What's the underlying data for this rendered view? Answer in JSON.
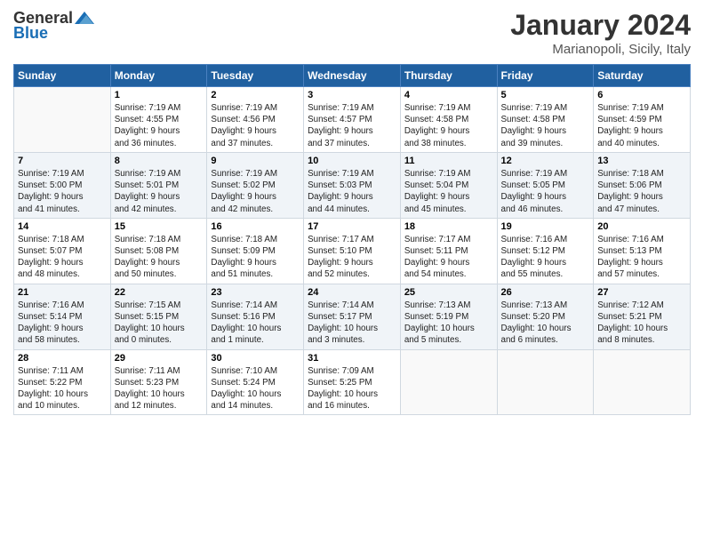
{
  "header": {
    "logo_general": "General",
    "logo_blue": "Blue",
    "month_title": "January 2024",
    "location": "Marianopoli, Sicily, Italy"
  },
  "days_of_week": [
    "Sunday",
    "Monday",
    "Tuesday",
    "Wednesday",
    "Thursday",
    "Friday",
    "Saturday"
  ],
  "weeks": [
    [
      {
        "day": "",
        "info": ""
      },
      {
        "day": "1",
        "info": "Sunrise: 7:19 AM\nSunset: 4:55 PM\nDaylight: 9 hours\nand 36 minutes."
      },
      {
        "day": "2",
        "info": "Sunrise: 7:19 AM\nSunset: 4:56 PM\nDaylight: 9 hours\nand 37 minutes."
      },
      {
        "day": "3",
        "info": "Sunrise: 7:19 AM\nSunset: 4:57 PM\nDaylight: 9 hours\nand 37 minutes."
      },
      {
        "day": "4",
        "info": "Sunrise: 7:19 AM\nSunset: 4:58 PM\nDaylight: 9 hours\nand 38 minutes."
      },
      {
        "day": "5",
        "info": "Sunrise: 7:19 AM\nSunset: 4:58 PM\nDaylight: 9 hours\nand 39 minutes."
      },
      {
        "day": "6",
        "info": "Sunrise: 7:19 AM\nSunset: 4:59 PM\nDaylight: 9 hours\nand 40 minutes."
      }
    ],
    [
      {
        "day": "7",
        "info": "Sunrise: 7:19 AM\nSunset: 5:00 PM\nDaylight: 9 hours\nand 41 minutes."
      },
      {
        "day": "8",
        "info": "Sunrise: 7:19 AM\nSunset: 5:01 PM\nDaylight: 9 hours\nand 42 minutes."
      },
      {
        "day": "9",
        "info": "Sunrise: 7:19 AM\nSunset: 5:02 PM\nDaylight: 9 hours\nand 42 minutes."
      },
      {
        "day": "10",
        "info": "Sunrise: 7:19 AM\nSunset: 5:03 PM\nDaylight: 9 hours\nand 44 minutes."
      },
      {
        "day": "11",
        "info": "Sunrise: 7:19 AM\nSunset: 5:04 PM\nDaylight: 9 hours\nand 45 minutes."
      },
      {
        "day": "12",
        "info": "Sunrise: 7:19 AM\nSunset: 5:05 PM\nDaylight: 9 hours\nand 46 minutes."
      },
      {
        "day": "13",
        "info": "Sunrise: 7:18 AM\nSunset: 5:06 PM\nDaylight: 9 hours\nand 47 minutes."
      }
    ],
    [
      {
        "day": "14",
        "info": "Sunrise: 7:18 AM\nSunset: 5:07 PM\nDaylight: 9 hours\nand 48 minutes."
      },
      {
        "day": "15",
        "info": "Sunrise: 7:18 AM\nSunset: 5:08 PM\nDaylight: 9 hours\nand 50 minutes."
      },
      {
        "day": "16",
        "info": "Sunrise: 7:18 AM\nSunset: 5:09 PM\nDaylight: 9 hours\nand 51 minutes."
      },
      {
        "day": "17",
        "info": "Sunrise: 7:17 AM\nSunset: 5:10 PM\nDaylight: 9 hours\nand 52 minutes."
      },
      {
        "day": "18",
        "info": "Sunrise: 7:17 AM\nSunset: 5:11 PM\nDaylight: 9 hours\nand 54 minutes."
      },
      {
        "day": "19",
        "info": "Sunrise: 7:16 AM\nSunset: 5:12 PM\nDaylight: 9 hours\nand 55 minutes."
      },
      {
        "day": "20",
        "info": "Sunrise: 7:16 AM\nSunset: 5:13 PM\nDaylight: 9 hours\nand 57 minutes."
      }
    ],
    [
      {
        "day": "21",
        "info": "Sunrise: 7:16 AM\nSunset: 5:14 PM\nDaylight: 9 hours\nand 58 minutes."
      },
      {
        "day": "22",
        "info": "Sunrise: 7:15 AM\nSunset: 5:15 PM\nDaylight: 10 hours\nand 0 minutes."
      },
      {
        "day": "23",
        "info": "Sunrise: 7:14 AM\nSunset: 5:16 PM\nDaylight: 10 hours\nand 1 minute."
      },
      {
        "day": "24",
        "info": "Sunrise: 7:14 AM\nSunset: 5:17 PM\nDaylight: 10 hours\nand 3 minutes."
      },
      {
        "day": "25",
        "info": "Sunrise: 7:13 AM\nSunset: 5:19 PM\nDaylight: 10 hours\nand 5 minutes."
      },
      {
        "day": "26",
        "info": "Sunrise: 7:13 AM\nSunset: 5:20 PM\nDaylight: 10 hours\nand 6 minutes."
      },
      {
        "day": "27",
        "info": "Sunrise: 7:12 AM\nSunset: 5:21 PM\nDaylight: 10 hours\nand 8 minutes."
      }
    ],
    [
      {
        "day": "28",
        "info": "Sunrise: 7:11 AM\nSunset: 5:22 PM\nDaylight: 10 hours\nand 10 minutes."
      },
      {
        "day": "29",
        "info": "Sunrise: 7:11 AM\nSunset: 5:23 PM\nDaylight: 10 hours\nand 12 minutes."
      },
      {
        "day": "30",
        "info": "Sunrise: 7:10 AM\nSunset: 5:24 PM\nDaylight: 10 hours\nand 14 minutes."
      },
      {
        "day": "31",
        "info": "Sunrise: 7:09 AM\nSunset: 5:25 PM\nDaylight: 10 hours\nand 16 minutes."
      },
      {
        "day": "",
        "info": ""
      },
      {
        "day": "",
        "info": ""
      },
      {
        "day": "",
        "info": ""
      }
    ]
  ]
}
